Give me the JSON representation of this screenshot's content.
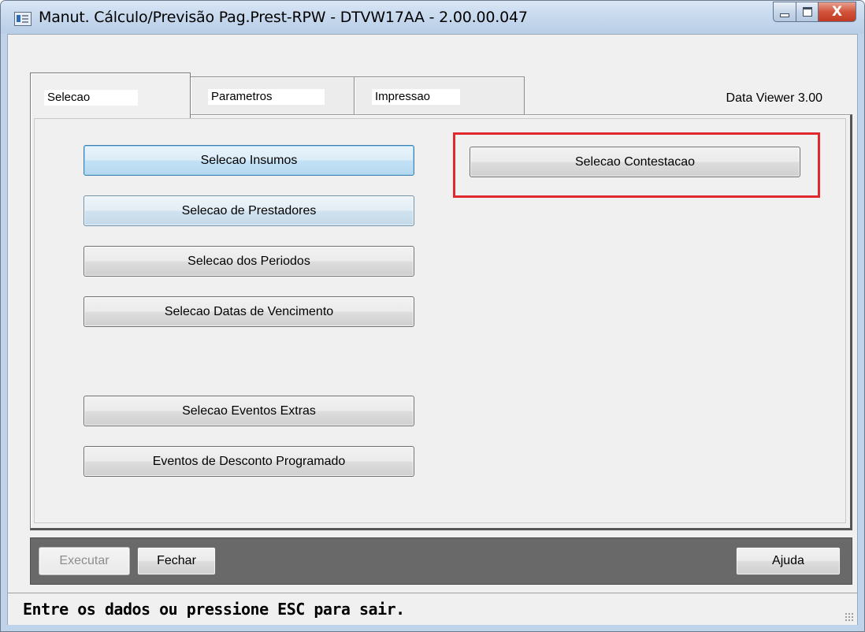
{
  "window": {
    "title": "Manut. Cálculo/Previsão Pag.Prest-RPW - DTVW17AA - 2.00.00.047",
    "controls": {
      "minimize": "minimize",
      "maximize": "maximize",
      "close": "X"
    }
  },
  "tabs": [
    {
      "label": "Selecao",
      "active": true
    },
    {
      "label": "Parametros",
      "active": false
    },
    {
      "label": "Impressao",
      "active": false
    }
  ],
  "viewer_label": "Data Viewer 3.00",
  "selection_buttons": {
    "insumos": "Selecao Insumos",
    "prestadores": "Selecao de Prestadores",
    "periodos": "Selecao dos Periodos",
    "datas_vencimento": "Selecao Datas de Vencimento",
    "eventos_extras": "Selecao Eventos Extras",
    "desconto_programado": "Eventos de Desconto Programado",
    "contestacao": "Selecao Contestacao"
  },
  "highlight": {
    "color": "#e0282f",
    "target": "Selecao Contestacao"
  },
  "actions": {
    "executar": "Executar",
    "fechar": "Fechar",
    "ajuda": "Ajuda"
  },
  "status_bar": {
    "message": "Entre os dados ou pressione ESC para sair."
  },
  "colors": {
    "titlebar": "#c3d6ec",
    "client": "#f0f0f0",
    "bottom_bar": "#696969",
    "focused_button": "#c3e1f5"
  }
}
